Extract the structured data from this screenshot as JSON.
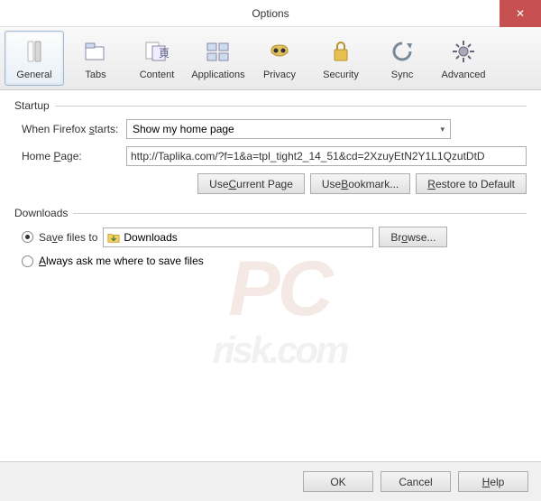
{
  "window": {
    "title": "Options"
  },
  "toolbar": {
    "items": [
      {
        "label": "General"
      },
      {
        "label": "Tabs"
      },
      {
        "label": "Content"
      },
      {
        "label": "Applications"
      },
      {
        "label": "Privacy"
      },
      {
        "label": "Security"
      },
      {
        "label": "Sync"
      },
      {
        "label": "Advanced"
      }
    ]
  },
  "startup": {
    "title": "Startup",
    "when_label": "When Firefox starts:",
    "when_value": "Show my home page",
    "homepage_label": "Home Page:",
    "homepage_value": "http://Taplika.com/?f=1&a=tpl_tight2_14_51&cd=2XzuyEtN2Y1L1QzutDtD",
    "use_current": "Use Current Page",
    "use_bookmark": "Use Bookmark...",
    "restore_default": "Restore to Default"
  },
  "downloads": {
    "title": "Downloads",
    "save_to_label": "Save files to",
    "save_path": "Downloads",
    "browse": "Browse...",
    "always_ask": "Always ask me where to save files"
  },
  "footer": {
    "ok": "OK",
    "cancel": "Cancel",
    "help": "Help"
  }
}
